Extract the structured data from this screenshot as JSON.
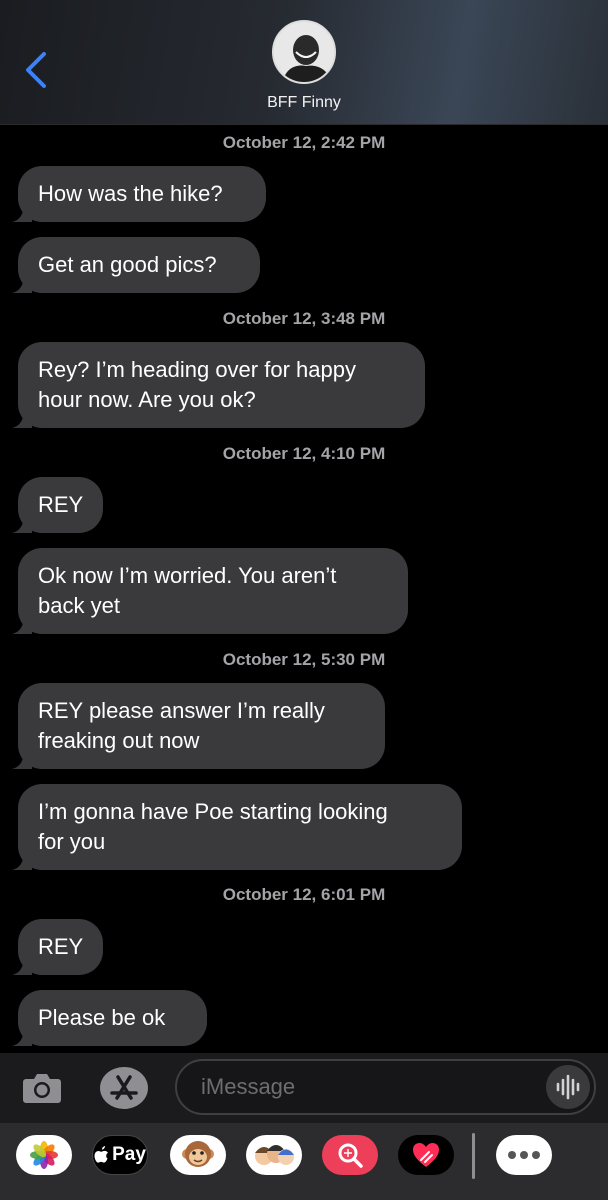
{
  "header": {
    "contact_name": "BFF Finny"
  },
  "thread": {
    "items": [
      {
        "type": "timestamp",
        "text": "October 12, 2:42 PM"
      },
      {
        "type": "received",
        "text": "How was the hike?"
      },
      {
        "type": "received",
        "text": "Get an good pics?"
      },
      {
        "type": "timestamp",
        "text": "October 12, 3:48 PM"
      },
      {
        "type": "received",
        "text": "Rey? I’m heading over for happy\nhour now. Are you ok?"
      },
      {
        "type": "timestamp",
        "text": "October 12, 4:10 PM"
      },
      {
        "type": "received",
        "text": "REY"
      },
      {
        "type": "received",
        "text": "Ok now I’m worried. You aren’t\nback yet"
      },
      {
        "type": "timestamp",
        "text": "October 12, 5:30 PM"
      },
      {
        "type": "received",
        "text": "REY please answer I’m really\nfreaking out now"
      },
      {
        "type": "received",
        "text": "I’m gonna have Poe starting looking\nfor you"
      },
      {
        "type": "timestamp",
        "text": "October 12, 6:01 PM"
      },
      {
        "type": "received",
        "text": "REY"
      },
      {
        "type": "received",
        "text": "Please be ok"
      }
    ]
  },
  "input_bar": {
    "placeholder": "iMessage"
  },
  "app_drawer": {
    "items": [
      {
        "icon": "photos-icon"
      },
      {
        "icon": "apple-pay-icon",
        "label": "Pay"
      },
      {
        "icon": "animoji-monkey-icon"
      },
      {
        "icon": "memoji-icon"
      },
      {
        "icon": "image-search-icon"
      },
      {
        "icon": "digital-touch-icon"
      },
      {
        "icon": "more-apps-icon"
      }
    ]
  },
  "colors": {
    "accent": "#3b82f6",
    "bubble_received": "#3a3a3c",
    "background": "#000000"
  }
}
